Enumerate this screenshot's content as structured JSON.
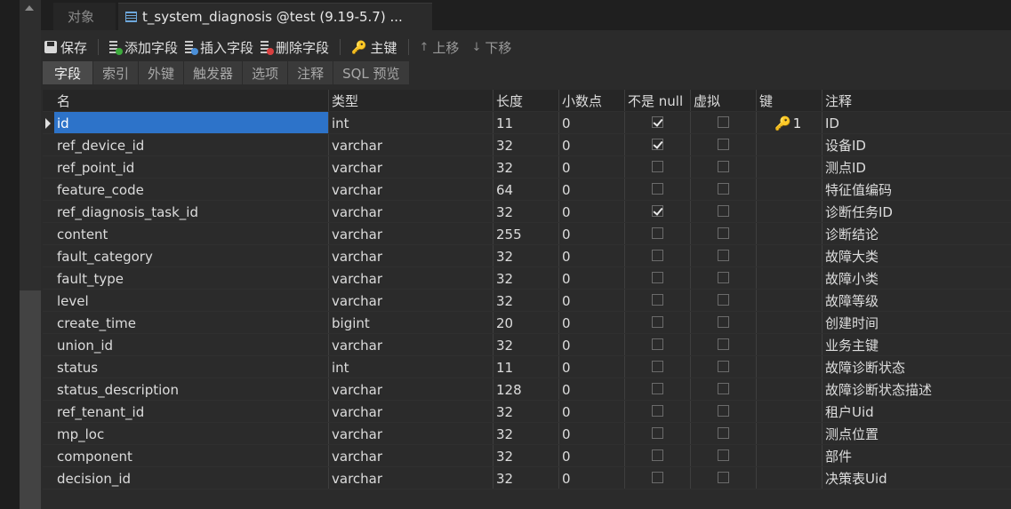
{
  "tabs": {
    "objects_label": "对象",
    "active_label": "t_system_diagnosis @test (9.19-5.7) ..."
  },
  "toolbar": {
    "save": "保存",
    "add_field": "添加字段",
    "insert_field": "插入字段",
    "delete_field": "删除字段",
    "primary_key": "主键",
    "move_up": "上移",
    "move_down": "下移"
  },
  "subtabs": [
    "字段",
    "索引",
    "外键",
    "触发器",
    "选项",
    "注释",
    "SQL 预览"
  ],
  "columns": {
    "name": "名",
    "type": "类型",
    "length": "长度",
    "decimals": "小数点",
    "not_null": "不是 null",
    "virtual": "虚拟",
    "key": "键",
    "comment": "注释"
  },
  "rows": [
    {
      "name": "id",
      "type": "int",
      "length": "11",
      "decimals": "0",
      "not_null": true,
      "virtual": false,
      "key": "1",
      "comment": "ID"
    },
    {
      "name": "ref_device_id",
      "type": "varchar",
      "length": "32",
      "decimals": "0",
      "not_null": true,
      "virtual": false,
      "key": "",
      "comment": "设备ID"
    },
    {
      "name": "ref_point_id",
      "type": "varchar",
      "length": "32",
      "decimals": "0",
      "not_null": false,
      "virtual": false,
      "key": "",
      "comment": "测点ID"
    },
    {
      "name": "feature_code",
      "type": "varchar",
      "length": "64",
      "decimals": "0",
      "not_null": false,
      "virtual": false,
      "key": "",
      "comment": "特征值编码"
    },
    {
      "name": "ref_diagnosis_task_id",
      "type": "varchar",
      "length": "32",
      "decimals": "0",
      "not_null": true,
      "virtual": false,
      "key": "",
      "comment": "诊断任务ID"
    },
    {
      "name": "content",
      "type": "varchar",
      "length": "255",
      "decimals": "0",
      "not_null": false,
      "virtual": false,
      "key": "",
      "comment": "诊断结论"
    },
    {
      "name": "fault_category",
      "type": "varchar",
      "length": "32",
      "decimals": "0",
      "not_null": false,
      "virtual": false,
      "key": "",
      "comment": "故障大类"
    },
    {
      "name": "fault_type",
      "type": "varchar",
      "length": "32",
      "decimals": "0",
      "not_null": false,
      "virtual": false,
      "key": "",
      "comment": "故障小类"
    },
    {
      "name": "level",
      "type": "varchar",
      "length": "32",
      "decimals": "0",
      "not_null": false,
      "virtual": false,
      "key": "",
      "comment": "故障等级"
    },
    {
      "name": "create_time",
      "type": "bigint",
      "length": "20",
      "decimals": "0",
      "not_null": false,
      "virtual": false,
      "key": "",
      "comment": "创建时间"
    },
    {
      "name": "union_id",
      "type": "varchar",
      "length": "32",
      "decimals": "0",
      "not_null": false,
      "virtual": false,
      "key": "",
      "comment": "业务主键"
    },
    {
      "name": "status",
      "type": "int",
      "length": "11",
      "decimals": "0",
      "not_null": false,
      "virtual": false,
      "key": "",
      "comment": "故障诊断状态"
    },
    {
      "name": "status_description",
      "type": "varchar",
      "length": "128",
      "decimals": "0",
      "not_null": false,
      "virtual": false,
      "key": "",
      "comment": "故障诊断状态描述"
    },
    {
      "name": "ref_tenant_id",
      "type": "varchar",
      "length": "32",
      "decimals": "0",
      "not_null": false,
      "virtual": false,
      "key": "",
      "comment": "租户Uid"
    },
    {
      "name": "mp_loc",
      "type": "varchar",
      "length": "32",
      "decimals": "0",
      "not_null": false,
      "virtual": false,
      "key": "",
      "comment": "测点位置"
    },
    {
      "name": "component",
      "type": "varchar",
      "length": "32",
      "decimals": "0",
      "not_null": false,
      "virtual": false,
      "key": "",
      "comment": "部件"
    },
    {
      "name": "decision_id",
      "type": "varchar",
      "length": "32",
      "decimals": "0",
      "not_null": false,
      "virtual": false,
      "key": "",
      "comment": "决策表Uid"
    }
  ],
  "selected_row": 0
}
